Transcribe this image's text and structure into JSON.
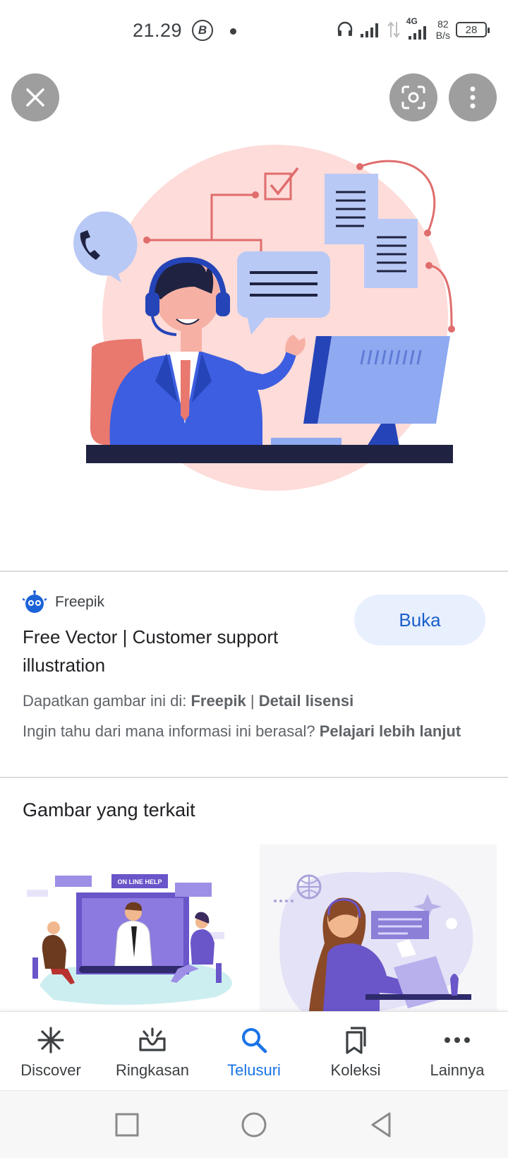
{
  "status_bar": {
    "time": "21.29",
    "b_icon": "B",
    "net_speed_value": "82",
    "net_speed_unit": "B/s",
    "network_type": "4G",
    "battery": "28"
  },
  "viewer": {
    "close_icon": "close-icon",
    "lens_icon": "lens-icon",
    "more_icon": "more-vert-icon"
  },
  "result": {
    "source": "Freepik",
    "title": "Free Vector | Customer support illustration",
    "open_button": "Buka",
    "license_prefix": "Dapatkan gambar ini di: ",
    "license_source": "Freepik",
    "license_sep": " | ",
    "license_detail": "Detail lisensi",
    "info_prefix": "Ingin tahu dari mana informasi ini berasal? ",
    "info_link": "Pelajari lebih lanjut"
  },
  "related": {
    "title": "Gambar yang terkait",
    "thumb1_banner": "ON LINE HELP"
  },
  "bottom_nav": {
    "items": [
      {
        "label": "Discover",
        "icon": "asterisk-icon"
      },
      {
        "label": "Ringkasan",
        "icon": "inbox-icon"
      },
      {
        "label": "Telusuri",
        "icon": "search-icon"
      },
      {
        "label": "Koleksi",
        "icon": "bookmarks-icon"
      },
      {
        "label": "Lainnya",
        "icon": "more-horiz-icon"
      }
    ],
    "active": "Telusuri"
  },
  "colors": {
    "accent": "#1a73e8",
    "button_bg": "#e8f0fe"
  }
}
